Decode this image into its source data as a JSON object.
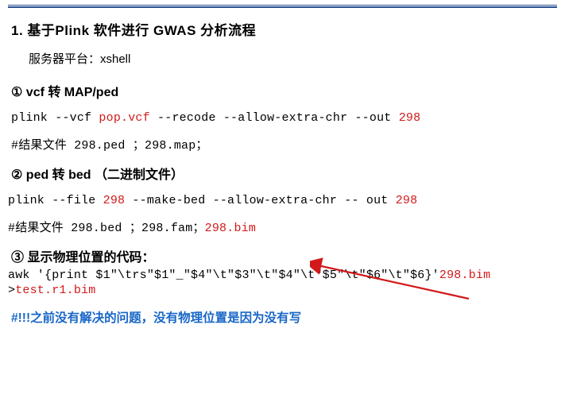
{
  "title": "1. 基于Plink 软件进行 GWAS 分析流程",
  "subtitle": "服务器平台：xshell",
  "step1": {
    "heading": "① vcf 转 MAP/ped",
    "cmd_pre": "plink --vcf ",
    "cmd_red1": "pop.vcf",
    "cmd_mid": " --recode --allow-extra-chr --out ",
    "cmd_red2": "298",
    "result": "#结果文件 298.ped ；298.map；"
  },
  "step2": {
    "heading": "② ped 转 bed （二进制文件）",
    "cmd_pre": "plink  --file ",
    "cmd_red1": "298",
    "cmd_mid": " --make-bed --allow-extra-chr -- out ",
    "cmd_red2": "298",
    "result_pre": "#结果文件 298.bed ；298.fam；",
    "result_red": "298.bim"
  },
  "step3": {
    "heading": "③ 显示物理位置的代码：",
    "cmd_pre": "awk '{print $1\"\\trs\"$1\"_\"$4\"\\t\"$3\"\\t\"$4\"\\t\"$5\"\\t\"$6\"\\t\"$6}'",
    "cmd_red1": "298.bim",
    "out_prefix": ">",
    "out_red": "test.r1.bim"
  },
  "note": "#!!!之前没有解决的问题，没有物理位置是因为没有写"
}
